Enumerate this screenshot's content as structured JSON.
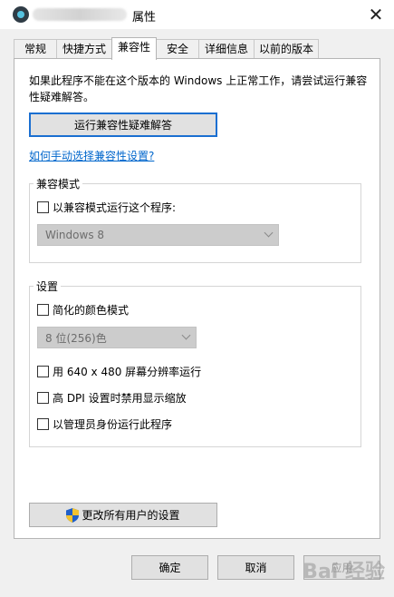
{
  "window": {
    "title": "属性",
    "close": "✕"
  },
  "tabs": [
    "常规",
    "快捷方式",
    "兼容性",
    "安全",
    "详细信息",
    "以前的版本"
  ],
  "compat": {
    "intro": "如果此程序不能在这个版本的 Windows 上正常工作，请尝试运行兼容性疑难解答。",
    "troubleshoot_button": "运行兼容性疑难解答",
    "manual_link": "如何手动选择兼容性设置?"
  },
  "compat_mode": {
    "group_label": "兼容模式",
    "checkbox_label": "以兼容模式运行这个程序:",
    "os_select_value": "Windows 8"
  },
  "settings": {
    "group_label": "设置",
    "reduced_color_label": "简化的颜色模式",
    "color_select_value": "8 位(256)色",
    "resolution_label": "用 640 x 480 屏幕分辨率运行",
    "dpi_label": "高 DPI 设置时禁用显示缩放",
    "admin_label": "以管理员身份运行此程序"
  },
  "all_users_button": "更改所有用户的设置",
  "footer": {
    "ok": "确定",
    "cancel": "取消",
    "apply": "应用"
  },
  "watermark": "Bai 经验"
}
